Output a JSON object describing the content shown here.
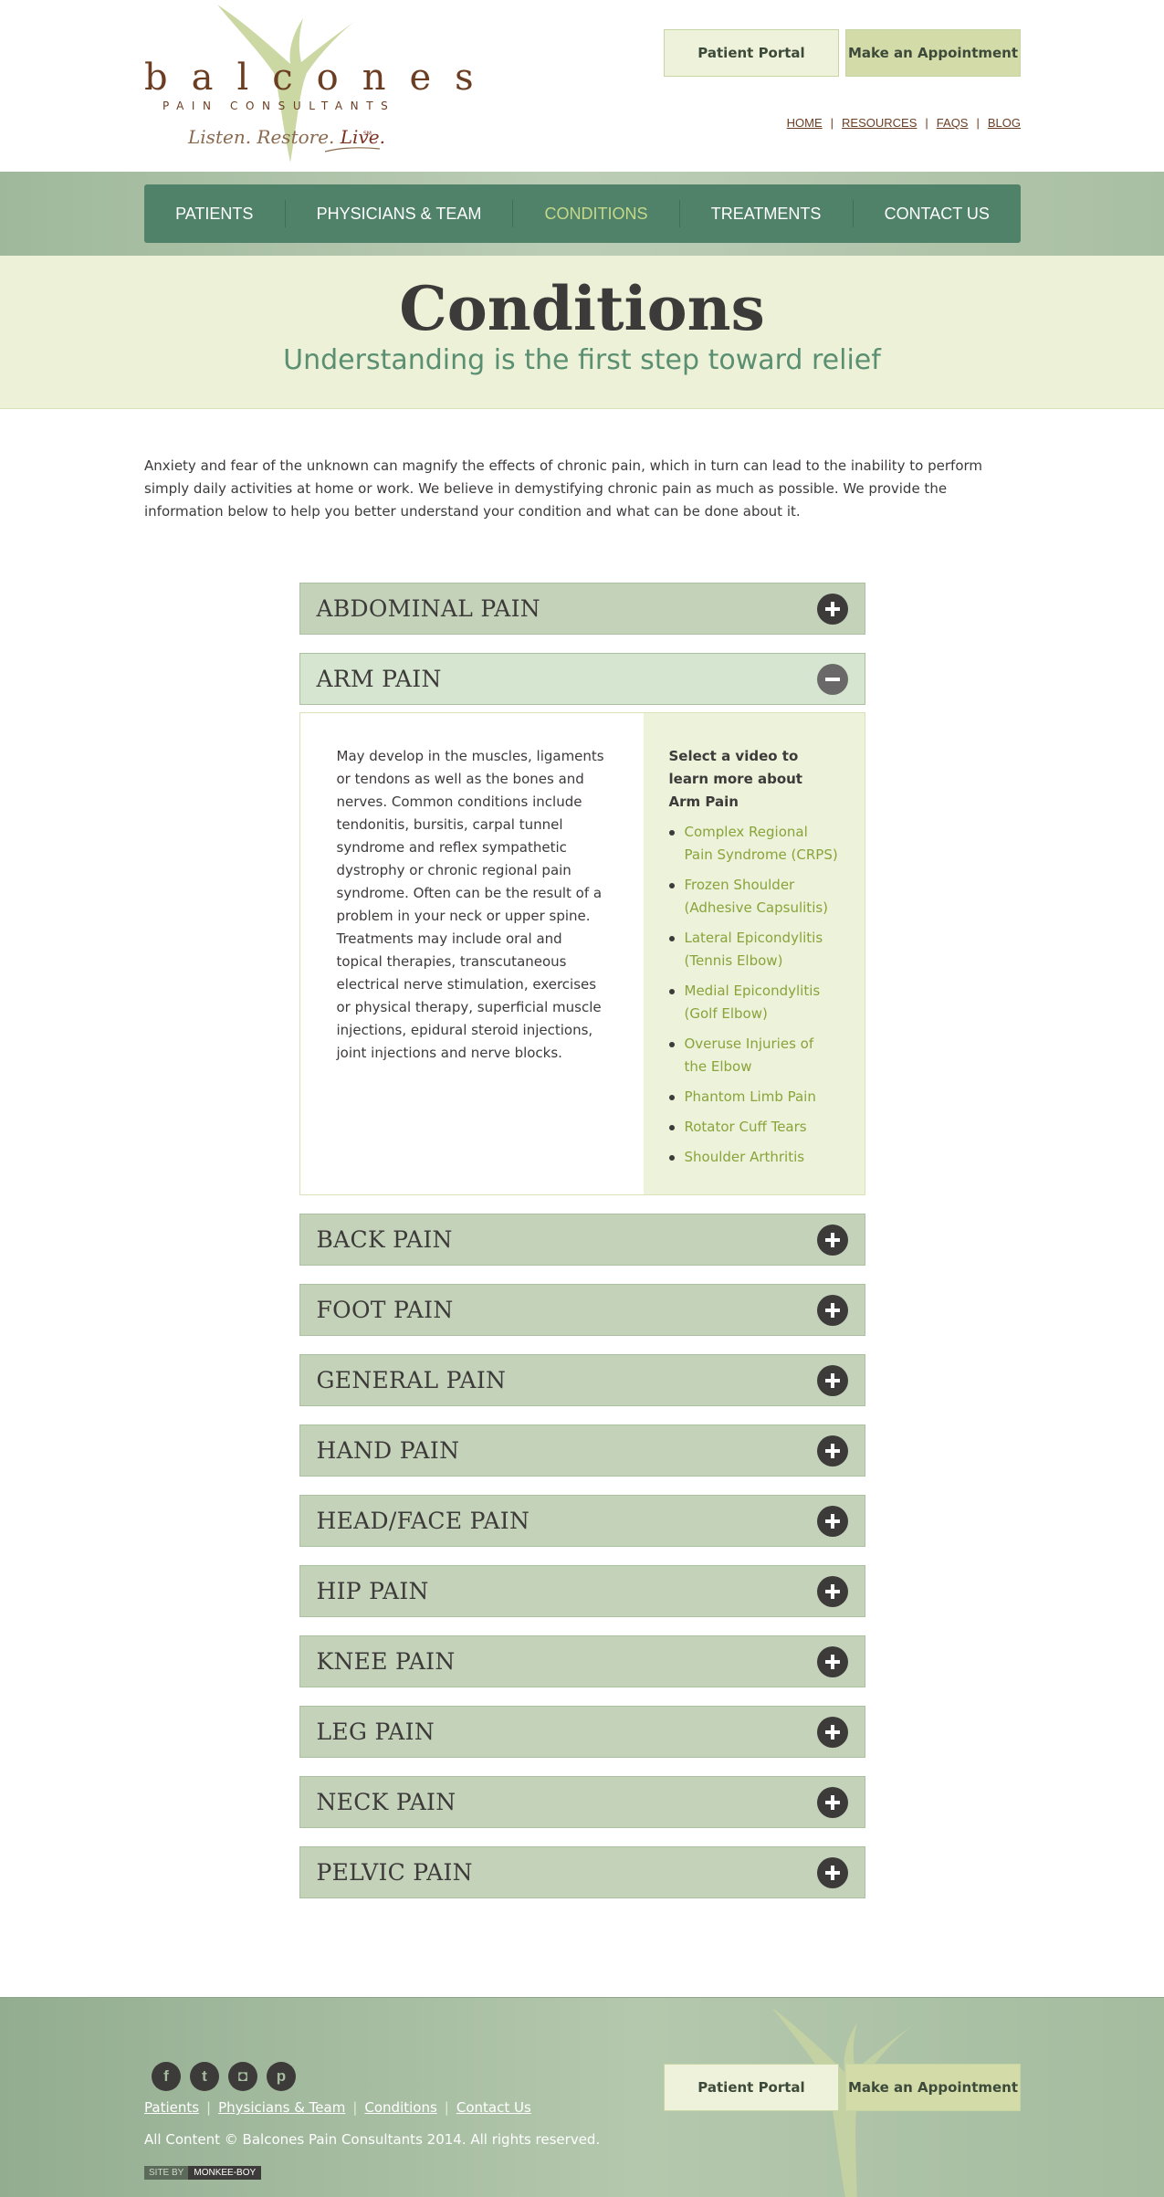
{
  "header": {
    "logo": {
      "wordmark": "balcones",
      "subtitle": "PAIN CONSULTANTS",
      "tagline_prefix": "Listen. Restore. ",
      "tagline_live": "Live.",
      "service_mark": "SM"
    },
    "portal_label": "Patient Portal",
    "appointment_label": "Make an Appointment",
    "util_links": [
      "HOME",
      "RESOURCES",
      "FAQS",
      "BLOG"
    ]
  },
  "nav": {
    "items": [
      {
        "label": "PATIENTS"
      },
      {
        "label": "PHYSICIANS & TEAM"
      },
      {
        "label": "CONDITIONS"
      },
      {
        "label": "TREATMENTS"
      },
      {
        "label": "CONTACT US"
      }
    ],
    "active_index": 2
  },
  "page": {
    "title": "Conditions",
    "subtitle": "Understanding is the first step toward relief",
    "intro": "Anxiety and fear of the unknown can magnify the effects of chronic pain, which in turn can lead to the inability to perform simply daily activities at home or work. We believe in demystifying chronic pain as much as possible. We provide the information below to help you better understand your condition and what can be done about it."
  },
  "accordion": {
    "sections": [
      {
        "title": "ABDOMINAL PAIN",
        "open": false
      },
      {
        "title": "ARM PAIN",
        "open": true
      },
      {
        "title": "BACK PAIN",
        "open": false
      },
      {
        "title": "FOOT PAIN",
        "open": false
      },
      {
        "title": "GENERAL PAIN",
        "open": false
      },
      {
        "title": "HAND PAIN",
        "open": false
      },
      {
        "title": "HEAD/FACE PAIN",
        "open": false
      },
      {
        "title": "HIP PAIN",
        "open": false
      },
      {
        "title": "KNEE PAIN",
        "open": false
      },
      {
        "title": "LEG PAIN",
        "open": false
      },
      {
        "title": "NECK PAIN",
        "open": false
      },
      {
        "title": "PELVIC PAIN",
        "open": false
      }
    ],
    "open_section": {
      "description": "May develop in the muscles, ligaments or tendons as well as the bones and nerves. Common conditions include tendonitis, bursitis, carpal tunnel syndrome and reflex sympathetic dystrophy or chronic regional pain syndrome. Often can be the result of a problem in your neck or upper spine. Treatments may include oral and topical therapies, transcutaneous electrical nerve stimulation, exercises or physical therapy, superficial muscle injections, epidural steroid injections, joint injections and nerve blocks.",
      "videos_heading": "Select a video to learn more about Arm Pain",
      "videos": [
        "Complex Regional Pain Syndrome (CRPS)",
        "Frozen Shoulder (Adhesive Capsulitis)",
        "Lateral Epicondylitis (Tennis Elbow)",
        "Medial Epicondylitis (Golf Elbow)",
        "Overuse Injuries of the Elbow",
        "Phantom Limb Pain",
        "Rotator Cuff Tears",
        "Shoulder Arthritis"
      ]
    }
  },
  "footer": {
    "social": [
      {
        "icon": "facebook-icon",
        "glyph": "f"
      },
      {
        "icon": "twitter-icon",
        "glyph": "t"
      },
      {
        "icon": "instagram-icon",
        "glyph": "◘"
      },
      {
        "icon": "pinterest-icon",
        "glyph": "p"
      }
    ],
    "links": [
      "Patients",
      "Physicians & Team",
      "Conditions",
      "Contact Us"
    ],
    "copyright": "All Content © Balcones Pain Consultants 2014. All rights reserved.",
    "site_by_label": "SITE BY",
    "site_by_name": "MONKEE-BOY",
    "portal_label": "Patient Portal",
    "appointment_label": "Make an Appointment"
  },
  "colors": {
    "nav_green": "#4f8268",
    "accent_olive": "#8aa33a",
    "logo_brown": "#6b3d22",
    "band_cream": "#ecf1d8"
  }
}
